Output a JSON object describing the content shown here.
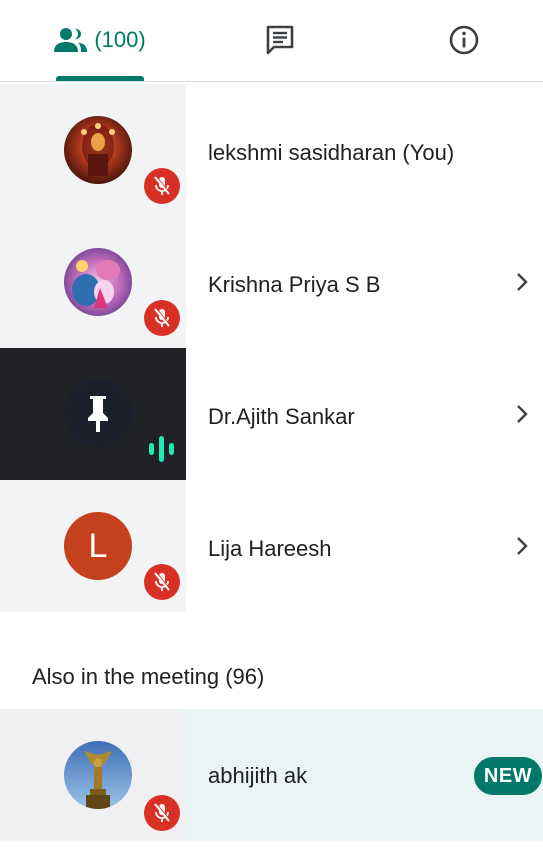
{
  "tabs": {
    "people_count": "(100)",
    "chat_icon": "chat-icon",
    "info_icon": "info-icon",
    "accent_color": "#00796b"
  },
  "participants": [
    {
      "name": "lekshmi sasidharan (You)",
      "muted": true,
      "has_chevron": false
    },
    {
      "name": "Krishna Priya S B",
      "muted": true,
      "has_chevron": true
    },
    {
      "name": "Dr.Ajith Sankar",
      "muted": false,
      "speaking": true,
      "has_chevron": true
    },
    {
      "name": "Lija Hareesh",
      "muted": true,
      "has_chevron": true,
      "avatar_letter": "L",
      "avatar_color": "#c5401c"
    }
  ],
  "also_in_meeting": {
    "label": "Also in the meeting (96)",
    "items": [
      {
        "name": "abhijith ak",
        "muted": true,
        "badge": "NEW"
      }
    ]
  },
  "colors": {
    "mute_red": "#d93025",
    "speaking_green": "#1de9b6",
    "highlight_bg": "#e8f5f4"
  }
}
